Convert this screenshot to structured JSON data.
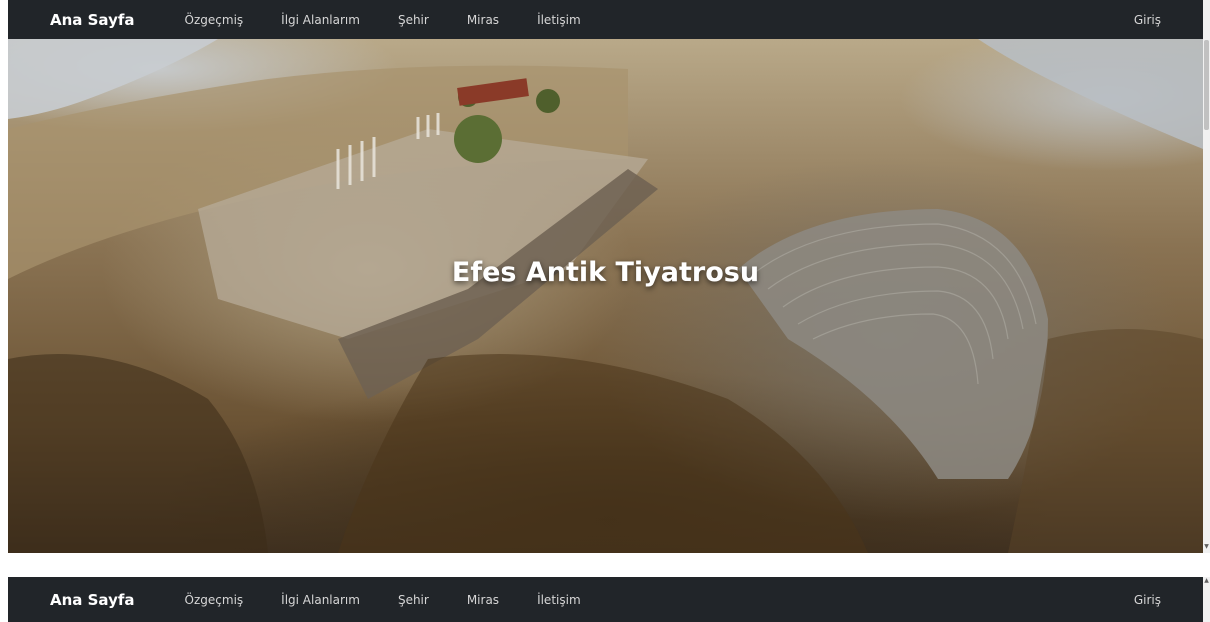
{
  "navbar": {
    "brand": "Ana Sayfa",
    "links": [
      "Özgeçmiş",
      "İlgi Alanlarım",
      "Şehir",
      "Miras",
      "İletişim"
    ],
    "login": "Giriş"
  },
  "hero": {
    "title": "Efes Antik Tiyatrosu"
  },
  "icons": {
    "scroll_up": "chevron-up-icon",
    "scroll_down": "chevron-down-icon"
  },
  "colors": {
    "navbar_bg": "#212529",
    "brand_text": "#ffffff",
    "link_text": "#d6d6d6"
  }
}
